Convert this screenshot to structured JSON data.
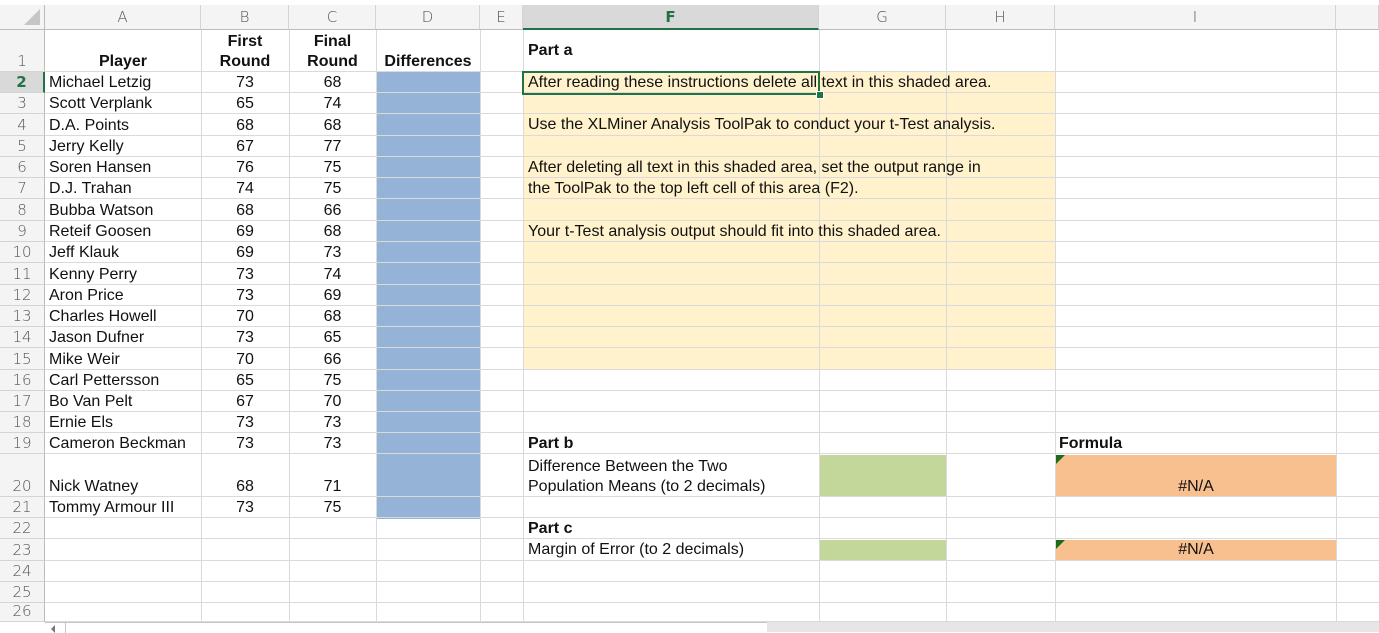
{
  "columns": [
    "A",
    "B",
    "C",
    "D",
    "E",
    "F",
    "G",
    "H",
    "I"
  ],
  "selected_column": "F",
  "rows": [
    "1",
    "2",
    "3",
    "4",
    "5",
    "6",
    "7",
    "8",
    "9",
    "10",
    "11",
    "12",
    "13",
    "14",
    "15",
    "16",
    "17",
    "18",
    "19",
    "20",
    "21",
    "22",
    "23",
    "24",
    "25",
    "26"
  ],
  "selected_row": "2",
  "headers": {
    "player": "Player",
    "first_round": "First\nRound",
    "first_round_l1": "First",
    "first_round_l2": "Round",
    "final_round_l1": "Final",
    "final_round_l2": "Round",
    "differences": "Differences"
  },
  "players": [
    {
      "name": "Michael Letzig",
      "first": "73",
      "final": "68"
    },
    {
      "name": "Scott Verplank",
      "first": "65",
      "final": "74"
    },
    {
      "name": "D.A. Points",
      "first": "68",
      "final": "68"
    },
    {
      "name": "Jerry Kelly",
      "first": "67",
      "final": "77"
    },
    {
      "name": "Soren Hansen",
      "first": "76",
      "final": "75"
    },
    {
      "name": "D.J. Trahan",
      "first": "74",
      "final": "75"
    },
    {
      "name": "Bubba Watson",
      "first": "68",
      "final": "66"
    },
    {
      "name": "Reteif Goosen",
      "first": "69",
      "final": "68"
    },
    {
      "name": "Jeff Klauk",
      "first": "69",
      "final": "73"
    },
    {
      "name": "Kenny Perry",
      "first": "73",
      "final": "74"
    },
    {
      "name": "Aron Price",
      "first": "73",
      "final": "69"
    },
    {
      "name": "Charles Howell",
      "first": "70",
      "final": "68"
    },
    {
      "name": "Jason Dufner",
      "first": "73",
      "final": "65"
    },
    {
      "name": "Mike Weir",
      "first": "70",
      "final": "66"
    },
    {
      "name": "Carl Pettersson",
      "first": "65",
      "final": "75"
    },
    {
      "name": "Bo Van Pelt",
      "first": "67",
      "final": "70"
    },
    {
      "name": "Ernie Els",
      "first": "73",
      "final": "73"
    },
    {
      "name": "Cameron Beckman",
      "first": "73",
      "final": "73"
    },
    {
      "name": "Nick Watney",
      "first": "68",
      "final": "71"
    },
    {
      "name": "Tommy Armour III",
      "first": "73",
      "final": "75"
    }
  ],
  "part_a": {
    "label": "Part a",
    "instructions": [
      "After reading these instructions delete all text in this shaded area.",
      "Use the XLMiner Analysis ToolPak to conduct your t-Test analysis.",
      "After deleting all text in this shaded area, set the output range in",
      "the ToolPak to the top left cell of this area (F2).",
      "Your t-Test analysis output should fit into this shaded area."
    ]
  },
  "part_b": {
    "label": "Part b",
    "desc_l1": "Difference Between the Two",
    "desc_l2": "Population Means (to 2 decimals)",
    "formula_value": "#N/A"
  },
  "part_c": {
    "label": "Part c",
    "desc": "Margin of Error (to 2 decimals)",
    "formula_value": "#N/A"
  },
  "formula_header": "Formula",
  "colors": {
    "differences_fill": "#95b3d7",
    "instructions_fill": "#fff2cc",
    "answer_fill": "#c4d79b",
    "formula_fill": "#f8bf8f",
    "selection": "#217346"
  }
}
